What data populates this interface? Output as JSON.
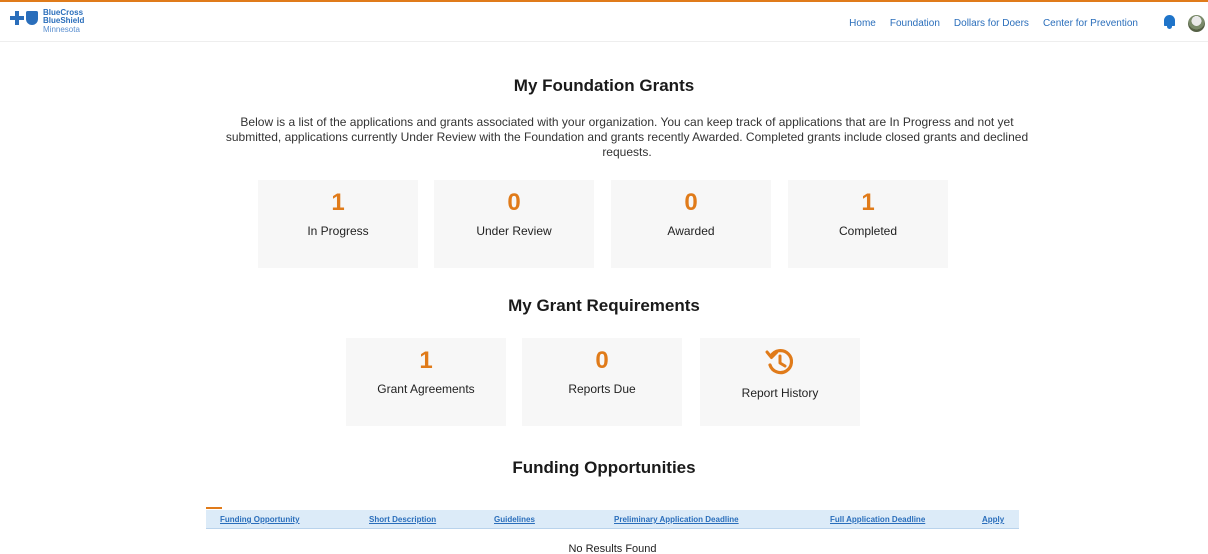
{
  "header": {
    "logo": {
      "line1": "BlueCross",
      "line2": "BlueShield",
      "line3": "Minnesota"
    },
    "nav": [
      "Home",
      "Foundation",
      "Dollars for Doers",
      "Center for Prevention"
    ],
    "accent_color": "#e07b1a",
    "link_color": "#2a6ebb"
  },
  "grants": {
    "title": "My Foundation Grants",
    "intro": "Below is a list of the applications and grants associated with your organization. You can keep track of applications that are In Progress and not yet submitted, applications currently Under Review with the Foundation and grants recently Awarded. Completed grants include closed grants and declined requests.",
    "cards": [
      {
        "count": "1",
        "label": "In Progress"
      },
      {
        "count": "0",
        "label": "Under Review"
      },
      {
        "count": "0",
        "label": "Awarded"
      },
      {
        "count": "1",
        "label": "Completed"
      }
    ]
  },
  "requirements": {
    "title": "My Grant Requirements",
    "cards": [
      {
        "count": "1",
        "label": "Grant Agreements"
      },
      {
        "count": "0",
        "label": "Reports Due"
      },
      {
        "icon": "history-icon",
        "label": "Report History"
      }
    ]
  },
  "funding": {
    "title": "Funding Opportunities",
    "columns": [
      "Funding Opportunity",
      "Short Description",
      "Guidelines",
      "Preliminary Application Deadline",
      "Full Application Deadline",
      "Apply"
    ],
    "empty_text": "No Results Found"
  }
}
